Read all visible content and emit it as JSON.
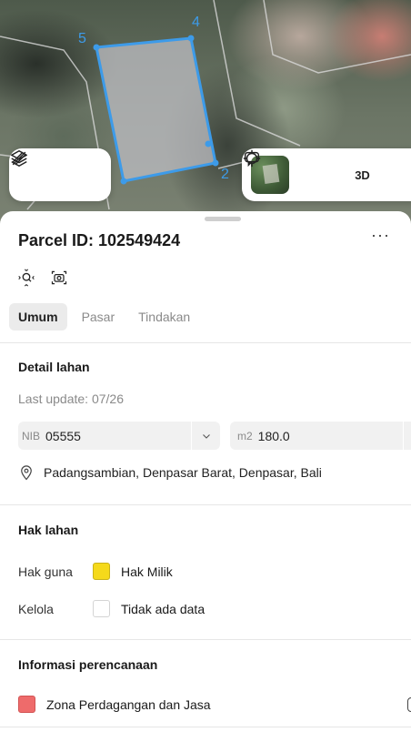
{
  "map": {
    "vertex_labels": [
      "5",
      "4",
      "2"
    ],
    "parcel_color": "#3d9be9",
    "left_toolbar": {
      "icons": [
        "layers-icon",
        "ruler-icon"
      ]
    },
    "right_toolbar": {
      "icons": [
        "basemap-thumbnail",
        "locate-icon",
        "3d-toggle",
        "chat-icon"
      ],
      "btn_3d_label": "3D"
    }
  },
  "sheet": {
    "title": "Parcel ID: 102549424",
    "more_label": "···",
    "tools": [
      "zoom-to-parcel-icon",
      "camera-icon"
    ],
    "tabs": [
      {
        "label": "Umum",
        "active": true
      },
      {
        "label": "Pasar",
        "active": false
      },
      {
        "label": "Tindakan",
        "active": false
      }
    ],
    "detail": {
      "title": "Detail lahan",
      "last_update": "Last update: 07/26",
      "nib_prefix": "NIB",
      "nib_value": "05555",
      "area_prefix": "m2",
      "area_value": "180.0",
      "address": "Padangsambian, Denpasar Barat, Denpasar, Bali"
    },
    "rights": {
      "title": "Hak lahan",
      "rows": [
        {
          "label": "Hak guna",
          "value": "Hak Milik",
          "swatch": "#f5d91b"
        },
        {
          "label": "Kelola",
          "value": "Tidak ada data",
          "swatch": "none"
        }
      ]
    },
    "planning": {
      "title": "Informasi perencanaan",
      "zone": "Zona Perdagangan dan Jasa",
      "zone_color": "#ee6b6b"
    }
  }
}
